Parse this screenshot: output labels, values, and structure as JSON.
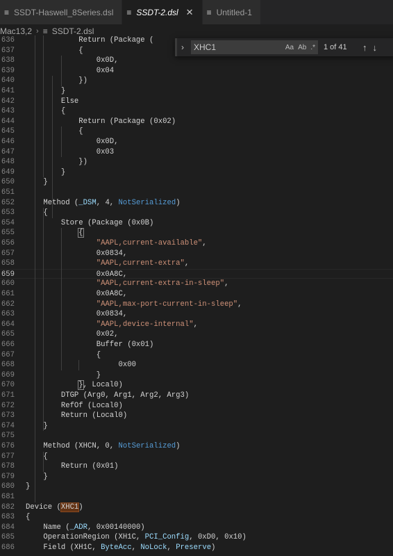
{
  "tabs": [
    {
      "label": "SSDT-Haswell_8Series.dsl",
      "active": false
    },
    {
      "label": "SSDT-2.dsl",
      "active": true
    },
    {
      "label": "Untitled-1",
      "active": false
    }
  ],
  "breadcrumbs": {
    "part1": "Mac13,2",
    "part2": "SSDT-2.dsl"
  },
  "find": {
    "value": "XHC1",
    "match_case": "Aa",
    "whole_word": "Ab",
    "regex": ".*",
    "count": "1 of 41"
  },
  "current_line": "659",
  "lines": [
    {
      "n": "636",
      "t": [
        [
          "p",
          "            Return (Package ("
        ]
      ]
    },
    {
      "n": "637",
      "t": [
        [
          "p",
          "            {"
        ]
      ]
    },
    {
      "n": "638",
      "t": [
        [
          "p",
          "                0x0D,"
        ]
      ]
    },
    {
      "n": "639",
      "t": [
        [
          "p",
          "                0x04"
        ]
      ]
    },
    {
      "n": "640",
      "t": [
        [
          "p",
          "            })"
        ]
      ]
    },
    {
      "n": "641",
      "t": [
        [
          "p",
          "        }"
        ]
      ]
    },
    {
      "n": "642",
      "t": [
        [
          "p",
          "        Else"
        ]
      ]
    },
    {
      "n": "643",
      "t": [
        [
          "p",
          "        {"
        ]
      ]
    },
    {
      "n": "644",
      "t": [
        [
          "p",
          "            Return (Package (0x02)"
        ]
      ]
    },
    {
      "n": "645",
      "t": [
        [
          "p",
          "            {"
        ]
      ]
    },
    {
      "n": "646",
      "t": [
        [
          "p",
          "                0x0D,"
        ]
      ]
    },
    {
      "n": "647",
      "t": [
        [
          "p",
          "                0x03"
        ]
      ]
    },
    {
      "n": "648",
      "t": [
        [
          "p",
          "            })"
        ]
      ]
    },
    {
      "n": "649",
      "t": [
        [
          "p",
          "        }"
        ]
      ]
    },
    {
      "n": "650",
      "t": [
        [
          "p",
          "    }"
        ]
      ]
    },
    {
      "n": "651",
      "t": [
        [
          "p",
          ""
        ]
      ]
    },
    {
      "n": "652",
      "t": [
        [
          "p",
          "    Method ("
        ],
        [
          "v",
          "_DSM"
        ],
        [
          "p",
          ", 4, "
        ],
        [
          "k",
          "NotSerialized"
        ],
        [
          "p",
          ")"
        ]
      ]
    },
    {
      "n": "653",
      "t": [
        [
          "p",
          "    {"
        ]
      ]
    },
    {
      "n": "654",
      "t": [
        [
          "p",
          "        Store (Package (0x0B)"
        ]
      ]
    },
    {
      "n": "655",
      "t": [
        [
          "p",
          "            "
        ],
        [
          "b",
          "{"
        ]
      ]
    },
    {
      "n": "656",
      "t": [
        [
          "p",
          "                "
        ],
        [
          "s",
          "\"AAPL,current-available\""
        ],
        [
          "p",
          ","
        ]
      ]
    },
    {
      "n": "657",
      "t": [
        [
          "p",
          "                0x0834,"
        ]
      ]
    },
    {
      "n": "658",
      "t": [
        [
          "p",
          "                "
        ],
        [
          "s",
          "\"AAPL,current-extra\""
        ],
        [
          "p",
          ","
        ]
      ]
    },
    {
      "n": "659",
      "t": [
        [
          "p",
          "                0x0A8C,"
        ]
      ]
    },
    {
      "n": "660",
      "t": [
        [
          "p",
          "                "
        ],
        [
          "s",
          "\"AAPL,current-extra-in-sleep\""
        ],
        [
          "p",
          ","
        ]
      ]
    },
    {
      "n": "661",
      "t": [
        [
          "p",
          "                0x0A8C,"
        ]
      ]
    },
    {
      "n": "662",
      "t": [
        [
          "p",
          "                "
        ],
        [
          "s",
          "\"AAPL,max-port-current-in-sleep\""
        ],
        [
          "p",
          ","
        ]
      ]
    },
    {
      "n": "663",
      "t": [
        [
          "p",
          "                0x0834,"
        ]
      ]
    },
    {
      "n": "664",
      "t": [
        [
          "p",
          "                "
        ],
        [
          "s",
          "\"AAPL,device-internal\""
        ],
        [
          "p",
          ","
        ]
      ]
    },
    {
      "n": "665",
      "t": [
        [
          "p",
          "                0x02,"
        ]
      ]
    },
    {
      "n": "666",
      "t": [
        [
          "p",
          "                Buffer (0x01)"
        ]
      ]
    },
    {
      "n": "667",
      "t": [
        [
          "p",
          "                {"
        ]
      ]
    },
    {
      "n": "668",
      "t": [
        [
          "p",
          "                     0x00"
        ]
      ]
    },
    {
      "n": "669",
      "t": [
        [
          "p",
          "                }"
        ]
      ]
    },
    {
      "n": "670",
      "t": [
        [
          "p",
          "            "
        ],
        [
          "b",
          "}"
        ],
        [
          "p",
          ", Local0)"
        ]
      ]
    },
    {
      "n": "671",
      "t": [
        [
          "p",
          "        DTGP (Arg0, Arg1, Arg2, Arg3)"
        ]
      ]
    },
    {
      "n": "672",
      "t": [
        [
          "p",
          "        RefOf (Local0)"
        ]
      ]
    },
    {
      "n": "673",
      "t": [
        [
          "p",
          "        Return (Local0)"
        ]
      ]
    },
    {
      "n": "674",
      "t": [
        [
          "p",
          "    }"
        ]
      ]
    },
    {
      "n": "675",
      "t": [
        [
          "p",
          ""
        ]
      ]
    },
    {
      "n": "676",
      "t": [
        [
          "p",
          "    Method (XHCN, 0, "
        ],
        [
          "k",
          "NotSerialized"
        ],
        [
          "p",
          ")"
        ]
      ]
    },
    {
      "n": "677",
      "t": [
        [
          "p",
          "    {"
        ]
      ]
    },
    {
      "n": "678",
      "t": [
        [
          "p",
          "        Return (0x01)"
        ]
      ]
    },
    {
      "n": "679",
      "t": [
        [
          "p",
          "    }"
        ]
      ]
    },
    {
      "n": "680",
      "t": [
        [
          "p",
          "}"
        ]
      ]
    },
    {
      "n": "681",
      "t": [
        [
          "p",
          ""
        ]
      ]
    },
    {
      "n": "682",
      "t": [
        [
          "p",
          "Device ("
        ],
        [
          "h",
          "XHC1"
        ],
        [
          "p",
          ")"
        ]
      ]
    },
    {
      "n": "683",
      "t": [
        [
          "p",
          "{"
        ]
      ]
    },
    {
      "n": "684",
      "t": [
        [
          "p",
          "    Name ("
        ],
        [
          "v",
          "_ADR"
        ],
        [
          "p",
          ", 0x00140000)"
        ]
      ]
    },
    {
      "n": "685",
      "t": [
        [
          "p",
          "    OperationRegion (XH1C, "
        ],
        [
          "v",
          "PCI_Config"
        ],
        [
          "p",
          ", 0xD0, 0x10)"
        ]
      ]
    },
    {
      "n": "686",
      "t": [
        [
          "p",
          "    Field (XH1C, "
        ],
        [
          "v",
          "ByteAcc"
        ],
        [
          "p",
          ", "
        ],
        [
          "v",
          "NoLock"
        ],
        [
          "p",
          ", "
        ],
        [
          "v",
          "Preserve"
        ],
        [
          "p",
          ")"
        ]
      ]
    }
  ]
}
